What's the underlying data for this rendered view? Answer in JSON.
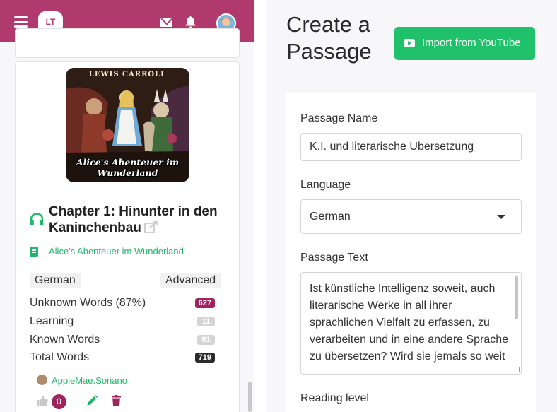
{
  "header": {
    "logo_text": "LT",
    "brand_color": "#b03a6e",
    "icons": [
      "hamburger-icon",
      "mail-icon",
      "bell-icon",
      "avatar"
    ]
  },
  "passage_card": {
    "cover": {
      "top_text": "LEWIS CARROLL",
      "bottom_text": "Alice's Abenteuer im Wunderland"
    },
    "chapter_title": "Chapter 1: Hinunter in den Kaninchenbau",
    "book_title": "Alice's Abenteuer im Wunderland",
    "language": "German",
    "level": "Advanced",
    "stats": [
      {
        "label": "Unknown Words (87%)",
        "value": "627",
        "color": "#a0245e"
      },
      {
        "label": "Learning",
        "value": "11",
        "color": "#d4d4d4"
      },
      {
        "label": "Known Words",
        "value": "81",
        "color": "#d4d4d4"
      },
      {
        "label": "Total Words",
        "value": "719",
        "color": "#2b2b2b"
      }
    ],
    "author": "AppleMae.Soriano",
    "likes": "0"
  },
  "form": {
    "title": "Create a Passage",
    "import_button": "Import from YouTube",
    "accent_color": "#1fc26a",
    "passage_name_label": "Passage Name",
    "passage_name_value": "K.I. und literarische Übersetzung",
    "language_label": "Language",
    "language_value": "German",
    "passage_text_label": "Passage Text",
    "passage_text_value": "Ist künstliche Intelligenz soweit, auch literarische Werke in all ihrer sprachlichen Vielfalt zu erfassen, zu verarbeiten und in eine andere Sprache zu übersetzen? Wird sie jemals so weit",
    "reading_level_label": "Reading level"
  }
}
